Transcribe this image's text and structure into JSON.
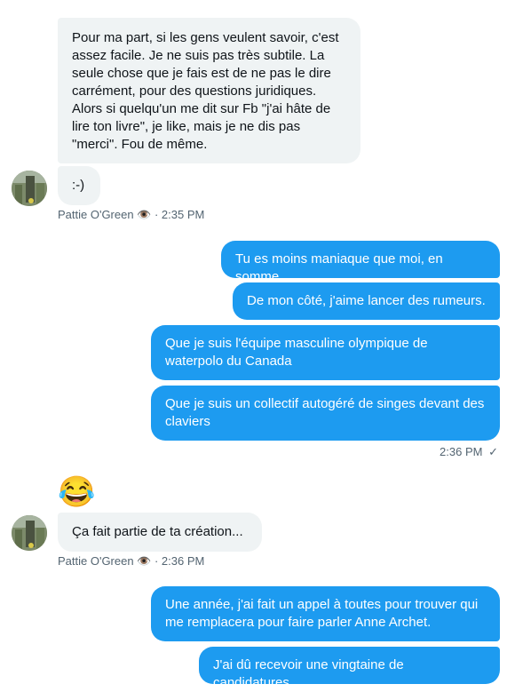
{
  "messages": {
    "m1": "Pour ma part, si les gens veulent savoir, c'est assez facile. Je ne suis pas très subtile. La seule chose que je fais est de ne pas le dire carrément, pour des questions juridiques. Alors si quelqu'un me dit sur Fb \"j'ai hâte de lire ton livre\", je like, mais je ne dis pas \"merci\". Fou de même.",
    "m2": ":-)",
    "meta1": "Pattie O'Green 👁️ · 2:35 PM",
    "o1": "Tu es moins maniaque que moi, en somme",
    "o2": "De mon côté, j'aime lancer des rumeurs.",
    "o3": "Que je suis l'équipe masculine olympique de waterpolo du Canada",
    "o4": "Que je suis un collectif autogéré de singes devant des claviers",
    "meta_out1": "2:36 PM",
    "check": "✓",
    "emoji": "😂",
    "m3": "Ça fait partie de ta création...",
    "meta2": "Pattie O'Green 👁️ · 2:36 PM",
    "o5": "Une année, j'ai fait un appel à toutes pour trouver qui me remplacera pour faire parler Anne Archet.",
    "o6": "J'ai dû recevoir une vingtaine de candidatures."
  }
}
